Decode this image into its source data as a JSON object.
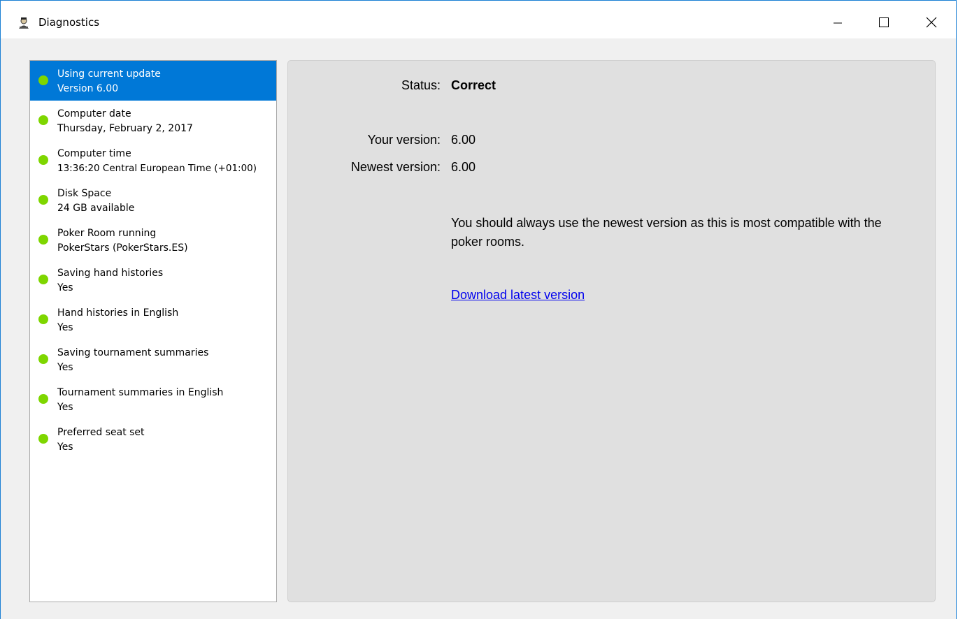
{
  "window": {
    "title": "Diagnostics",
    "icon": "poker-player-icon",
    "controls": [
      "minimize-icon",
      "maximize-icon",
      "close-icon"
    ]
  },
  "colors": {
    "window_border": "#1a7fd4",
    "selected_bg": "#0078d7",
    "status_dot": "#7ed600",
    "panel_bg": "#e0e0e0",
    "link": "#0000ee"
  },
  "checks": [
    {
      "title": "Using current update",
      "detail": "Version 6.00",
      "selected": true
    },
    {
      "title": "Computer date",
      "detail": "Thursday, February 2, 2017"
    },
    {
      "title": "Computer time",
      "detail": "13:36:20 Central European Time (+01:00)"
    },
    {
      "title": "Disk Space",
      "detail": "24 GB available"
    },
    {
      "title": "Poker Room running",
      "detail": "PokerStars (PokerStars.ES)"
    },
    {
      "title": "Saving hand histories",
      "detail": "Yes"
    },
    {
      "title": "Hand histories in English",
      "detail": "Yes"
    },
    {
      "title": "Saving tournament summaries",
      "detail": "Yes"
    },
    {
      "title": "Tournament summaries in English",
      "detail": "Yes"
    },
    {
      "title": "Preferred seat set",
      "detail": "Yes"
    }
  ],
  "detail": {
    "status_label": "Status:",
    "status_value": "Correct",
    "your_version_label": "Your version:",
    "your_version_value": "6.00",
    "newest_version_label": "Newest version:",
    "newest_version_value": "6.00",
    "description": "You should always use the newest version as this is most compatible with the poker rooms.",
    "link_text": "Download latest version"
  }
}
